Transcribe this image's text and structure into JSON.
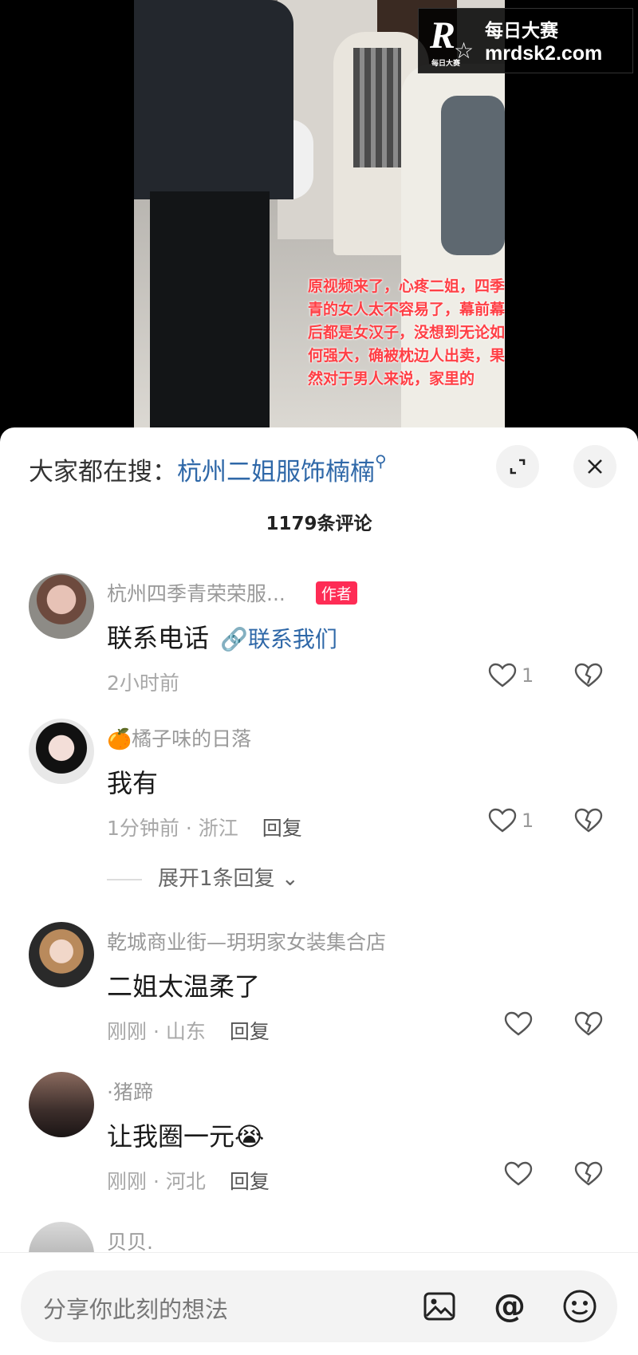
{
  "video": {
    "caption": "原视频来了，心疼二姐，四季青的女人太不容易了，幕前幕后都是女汉子，没想到无论如何强大，确被枕边人出卖，果然对于男人来说，家里的"
  },
  "watermark": {
    "logo": "R",
    "logo_small": "每日大赛",
    "title": "每日大赛",
    "url": "mrdsk2.com"
  },
  "header": {
    "search_prefix": "大家都在搜：",
    "search_term": "杭州二姐服饰楠楠",
    "comment_count": "1179条评论"
  },
  "comments": [
    {
      "name": "杭州四季青荣荣服...",
      "badge": "作者",
      "text": "联系电话",
      "link": "联系我们",
      "meta": "2小时前",
      "likes": "1"
    },
    {
      "name": "🍊橘子味的日落",
      "text": "我有",
      "meta": "1分钟前 · 浙江",
      "reply": "回复",
      "likes": "1",
      "expand": "展开1条回复"
    },
    {
      "name": "乾城商业街—玥玥家女装集合店",
      "text": "二姐太温柔了",
      "meta": "刚刚 · 山东",
      "reply": "回复",
      "likes": ""
    },
    {
      "name": "·猪蹄",
      "text": "让我圈一元😭",
      "meta": "刚刚 · 河北",
      "reply": "回复",
      "likes": ""
    },
    {
      "name": "贝贝."
    }
  ],
  "input": {
    "placeholder": "分享你此刻的想法"
  },
  "colors": {
    "accent_link": "#2f68a8",
    "author_badge": "#fe2c55",
    "caption_red": "#ff3f45"
  }
}
